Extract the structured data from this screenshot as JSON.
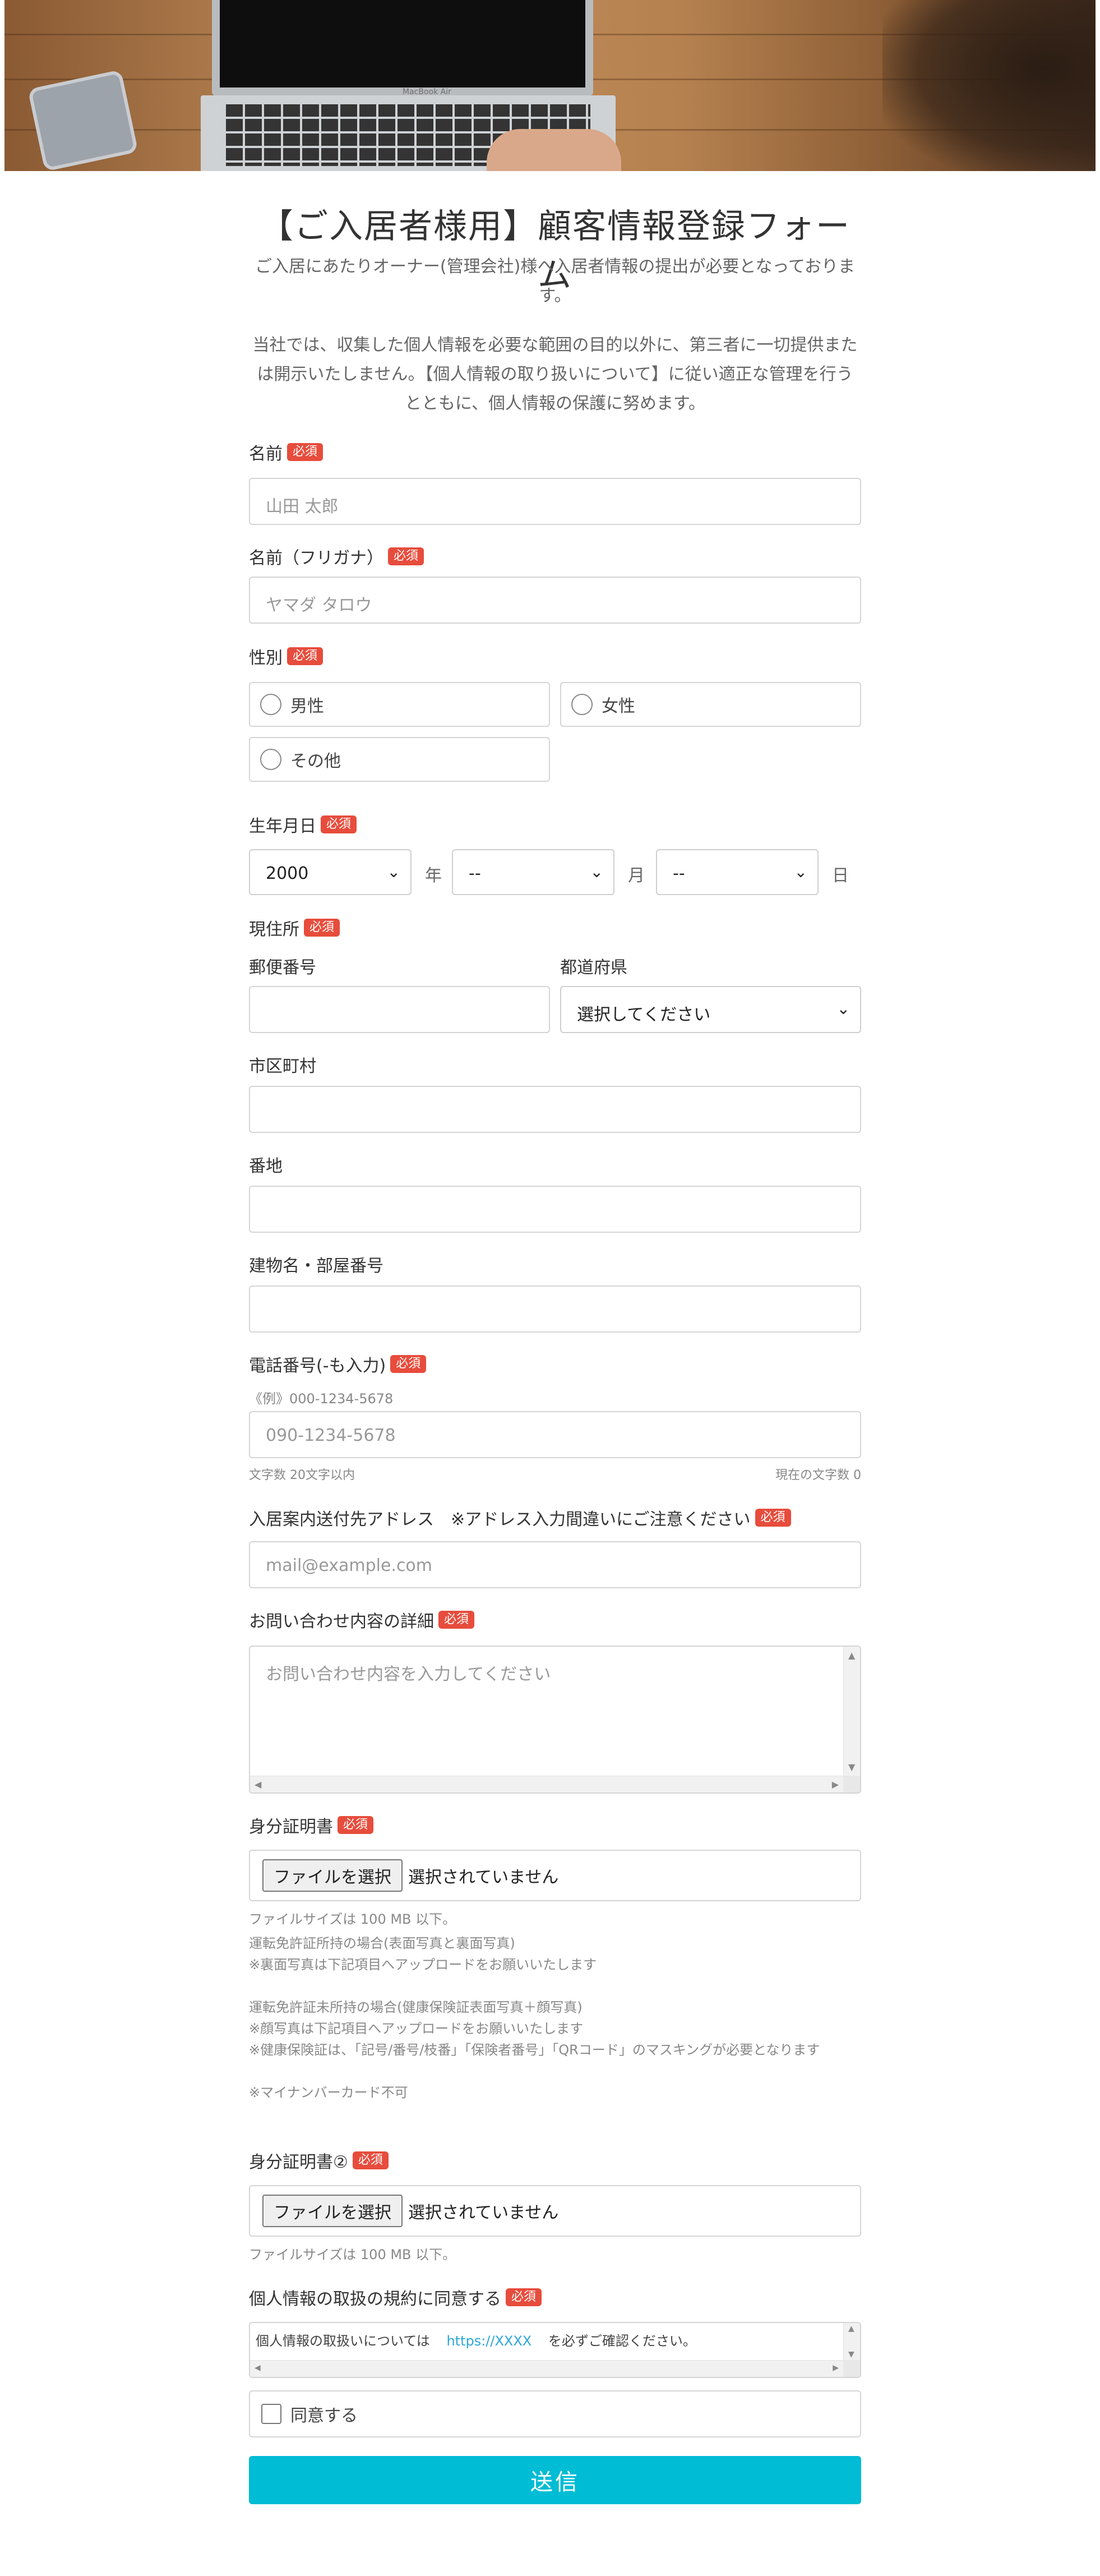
{
  "hero": {
    "icon": "laptop-photo",
    "brand_text": "MacBook Air"
  },
  "form": {
    "title": "【ご入居者様用】顧客情報登録フォーム",
    "intro_1": "ご入居にあたりオーナー(管理会社)様へ入居者情報の提出が必要となっております。",
    "intro_2": "当社では、収集した個人情報を必要な範囲の目的以外に、第三者に一切提供または開示いたしません。【個人情報の取り扱いについて】に従い適正な管理を行うとともに、個人情報の保護に努めます。",
    "required_badge": "必須"
  },
  "name": {
    "label": "名前",
    "placeholder": "山田 太郎"
  },
  "kana": {
    "label": "名前（フリガナ）",
    "placeholder": "ヤマダ タロウ"
  },
  "gender": {
    "label": "性別",
    "options": [
      "男性",
      "女性",
      "その他"
    ]
  },
  "birth": {
    "label": "生年月日",
    "year": "2000",
    "year_unit": "年",
    "month": "--",
    "month_unit": "月",
    "day": "--",
    "day_unit": "日"
  },
  "address": {
    "label": "現住所",
    "postal_label": "郵便番号",
    "prefecture_label": "都道府県",
    "prefecture_value": "選択してください",
    "city_label": "市区町村",
    "street_label": "番地",
    "building_label": "建物名・部屋番号"
  },
  "phone": {
    "label": "電話番号(-も入力)",
    "example": "《例》000-1234-5678",
    "placeholder": "090-1234-5678",
    "limit": "文字数 20文字以内",
    "count": "現在の文字数 0"
  },
  "email": {
    "label": "入居案内送付先アドレス　※アドレス入力間違いにご注意ください",
    "placeholder": "mail@example.com"
  },
  "inquiry": {
    "label": "お問い合わせ内容の詳細",
    "placeholder": "お問い合わせ内容を入力してください"
  },
  "id_doc": {
    "label": "身分証明書",
    "button": "ファイルを選択",
    "status": "選択されていません",
    "size_note": "ファイルサイズは 100 MB 以下。",
    "note_1": "運転免許証所持の場合(表面写真と裏面写真)",
    "note_2": "※裏面写真は下記項目へアップロードをお願いいたします",
    "note_3": "運転免許証未所持の場合(健康保険証表面写真＋顔写真)",
    "note_4": "※顔写真は下記項目へアップロードをお願いいたします",
    "note_5": "※健康保険証は、「記号/番号/枝番」「保険者番号」「QRコード」のマスキングが必要となります",
    "note_6": "※マイナンバーカード不可"
  },
  "id_doc2": {
    "label": "身分証明書②",
    "button": "ファイルを選択",
    "status": "選択されていません",
    "size_note": "ファイルサイズは 100 MB 以下。"
  },
  "privacy": {
    "label": "個人情報の取扱の規約に同意する",
    "text_before": "個人情報の取扱いについては",
    "link": "https://XXXX",
    "text_after": "を必ずご確認ください。",
    "agree": "同意する"
  },
  "submit": {
    "label": "送信"
  }
}
